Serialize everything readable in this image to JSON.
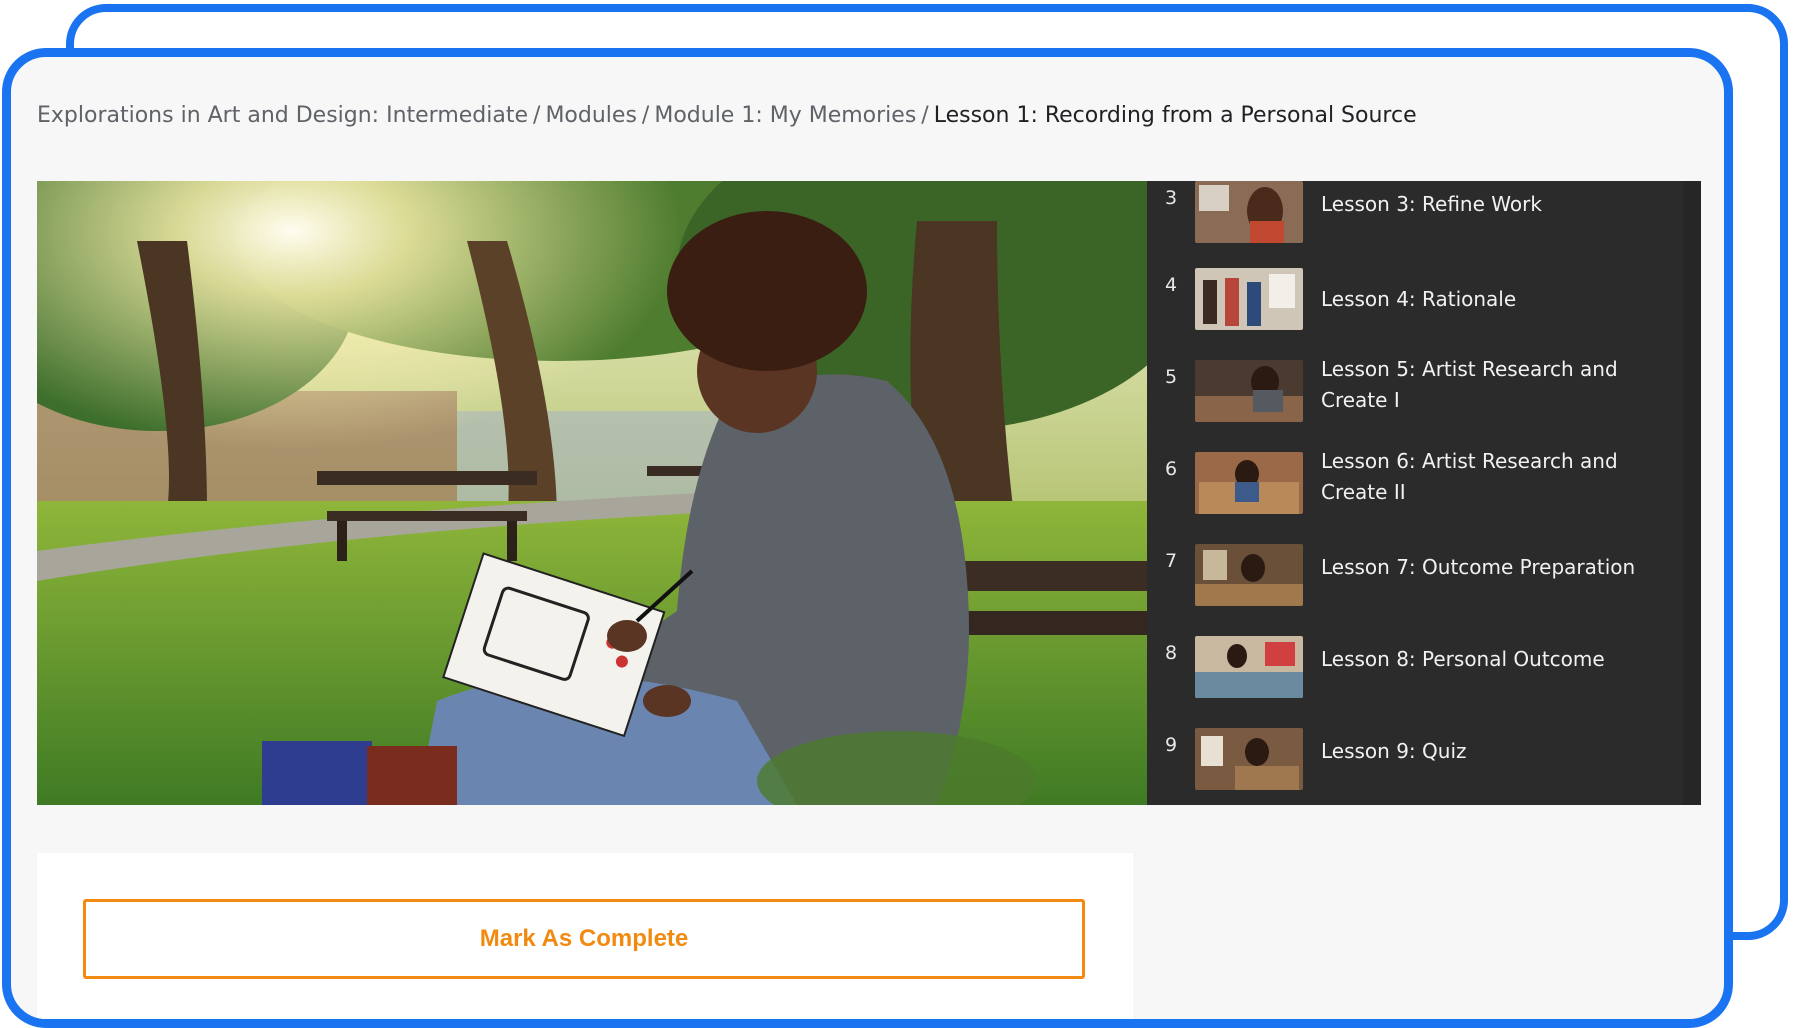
{
  "breadcrumb": {
    "items": [
      "Explorations in Art and Design: Intermediate",
      "Modules",
      "Module 1: My Memories"
    ],
    "current": "Lesson 1: Recording from a Personal Source",
    "separator": "/"
  },
  "hero": {
    "image_icon": "lesson-hero-image"
  },
  "playlist": {
    "lessons": [
      {
        "number": "3",
        "title": "Lesson 3: Refine Work"
      },
      {
        "number": "4",
        "title": "Lesson 4: Rationale"
      },
      {
        "number": "5",
        "title": "Lesson 5: Artist Research and Create I"
      },
      {
        "number": "6",
        "title": "Lesson 6: Artist Research and Create II"
      },
      {
        "number": "7",
        "title": "Lesson 7: Outcome Preparation"
      },
      {
        "number": "8",
        "title": "Lesson 8: Personal Outcome"
      },
      {
        "number": "9",
        "title": "Lesson 9: Quiz"
      }
    ]
  },
  "actions": {
    "mark_complete_label": "Mark As Complete"
  },
  "colors": {
    "frame_blue": "#1a73f0",
    "accent_orange": "#f28a12",
    "playlist_bg": "#2b2b2b"
  }
}
